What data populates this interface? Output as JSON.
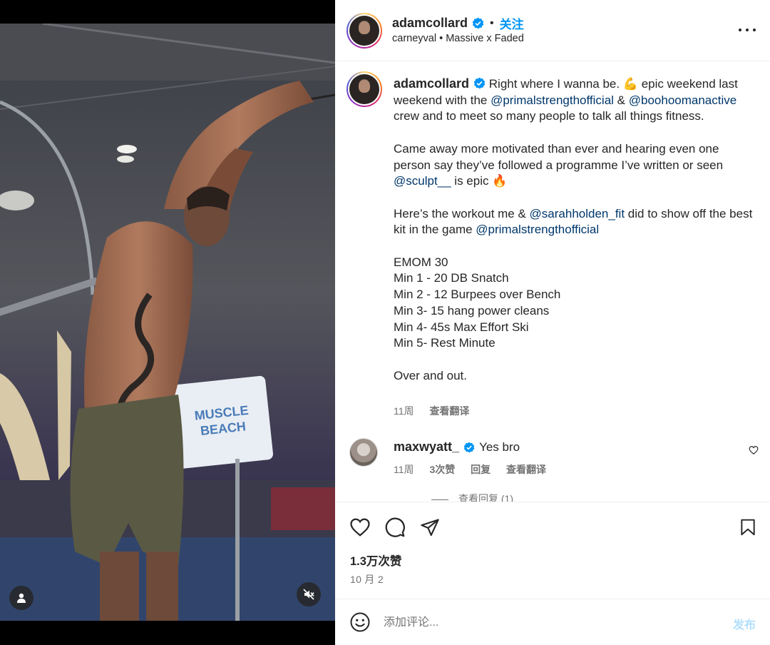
{
  "post": {
    "author": "adamcollard",
    "follow_label": "关注",
    "separator": "•",
    "subtitle": "carneyval • Massive x Faded",
    "caption_parts": [
      "Right where I wanna be. 💪 epic weekend last weekend with the ",
      "@primalstrengthofficial",
      " & ",
      "@boohoomanactive",
      " crew and to meet so many people to talk all things fitness.\n\nCame away more motivated than ever and hearing even one person say they’ve followed a programme I’ve written or seen ",
      "@sculpt__",
      " is epic 🔥\n\nHere’s the workout me & ",
      "@sarahholden_fit",
      " did to show off the best kit in the game ",
      "@primalstrengthofficial",
      "\n\nEMOM 30\nMin 1 - 20 DB Snatch\nMin 2 - 12 Burpees over Bench\nMin 3- 15 hang power cleans\nMin 4- 45s Max Effort Ski\nMin 5- Rest Minute\n\nOver and out."
    ],
    "caption_time": "11周",
    "caption_translate": "查看翻译",
    "likes": "1.3万次赞",
    "date": "10 月 2"
  },
  "comment": {
    "author": "maxwyatt_",
    "text": "Yes bro",
    "time": "11周",
    "likes": "3次赞",
    "reply": "回复",
    "translate": "查看翻译",
    "view_replies": "查看回复 (1)"
  },
  "composer": {
    "placeholder": "添加评论...",
    "post_label": "发布"
  },
  "colors": {
    "accent": "#0095f6",
    "mention": "#00376b",
    "muted": "#737373",
    "post_disabled": "#b2dffc"
  },
  "icons": [
    "more-icon",
    "verified-icon",
    "heart-icon",
    "comment-icon",
    "share-icon",
    "bookmark-icon",
    "emoji-icon",
    "user-tag-icon",
    "mute-icon"
  ]
}
